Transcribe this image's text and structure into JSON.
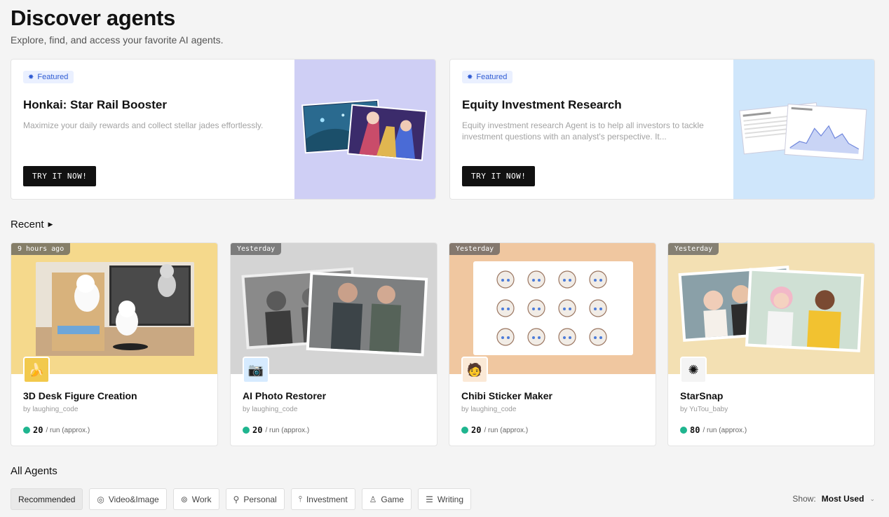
{
  "header": {
    "title": "Discover agents",
    "subtitle": "Explore, find, and access your favorite AI agents."
  },
  "featured": [
    {
      "badge": "Featured",
      "title": "Honkai: Star Rail Booster",
      "description": "Maximize your daily rewards and collect stellar jades effortlessly.",
      "button": "TRY IT NOW!",
      "art_bg": "#cfcff5"
    },
    {
      "badge": "Featured",
      "title": "Equity Investment Research",
      "description": "Equity investment research Agent is to help all investors to tackle investment questions with an analyst's perspective. It...",
      "button": "TRY IT NOW!",
      "art_bg": "#cfe6fb"
    }
  ],
  "recent": {
    "label": "Recent",
    "items": [
      {
        "time": "9 hours ago",
        "title": "3D Desk Figure Creation",
        "author": "by laughing_code",
        "cost": "20",
        "cost_suffix": "/ run (approx.)",
        "thumb_bg": "#f5d98c",
        "icon": "banana-icon"
      },
      {
        "time": "Yesterday",
        "title": "AI Photo Restorer",
        "author": "by laughing_code",
        "cost": "20",
        "cost_suffix": "/ run (approx.)",
        "thumb_bg": "#d4d4d4",
        "icon": "camera-icon"
      },
      {
        "time": "Yesterday",
        "title": "Chibi Sticker Maker",
        "author": "by laughing_code",
        "cost": "20",
        "cost_suffix": "/ run (approx.)",
        "thumb_bg": "#f0c7a0",
        "icon": "chibi-avatar-icon"
      },
      {
        "time": "Yesterday",
        "title": "StarSnap",
        "author": "by YuTou_baby",
        "cost": "80",
        "cost_suffix": "/ run (approx.)",
        "thumb_bg": "#f3e0b3",
        "icon": "star-badge-icon"
      }
    ]
  },
  "all_agents": {
    "label": "All Agents",
    "filters": [
      {
        "label": "Recommended",
        "icon": ""
      },
      {
        "label": "Video&Image",
        "icon": "target-icon"
      },
      {
        "label": "Work",
        "icon": "briefcase-icon"
      },
      {
        "label": "Personal",
        "icon": "person-icon"
      },
      {
        "label": "Investment",
        "icon": "chart-icon"
      },
      {
        "label": "Game",
        "icon": "joystick-icon"
      },
      {
        "label": "Writing",
        "icon": "pen-icon"
      }
    ],
    "show_label": "Show:",
    "show_value": "Most Used"
  }
}
